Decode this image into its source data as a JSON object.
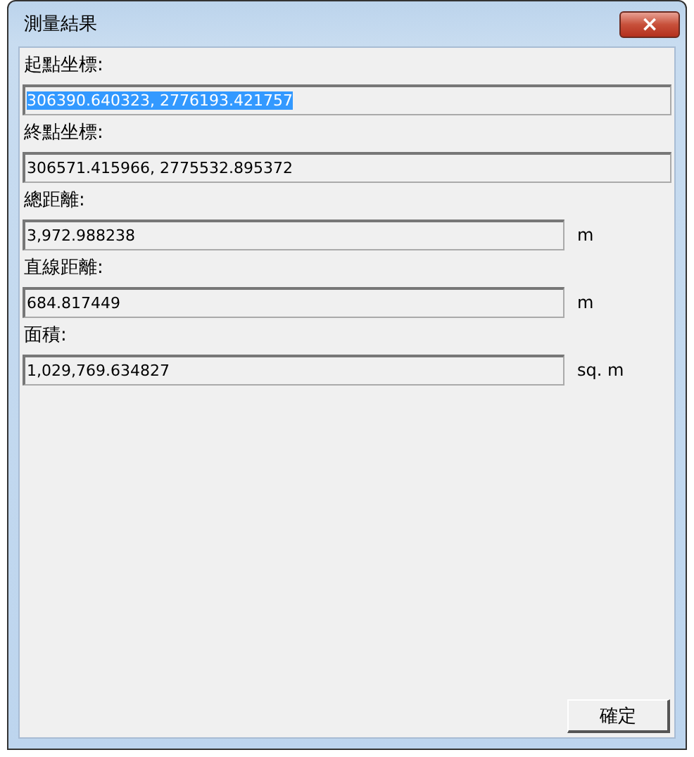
{
  "window": {
    "title": "測量結果",
    "close": "×"
  },
  "fields": [
    {
      "label": "起點坐標:",
      "value": "306390.640323, 2776193.421757",
      "selected": true
    },
    {
      "label": "終點坐標:",
      "value": "306571.415966, 2775532.895372",
      "selected": false
    },
    {
      "label": "總距離:",
      "value": "3,972.988238",
      "unit": "m",
      "selected": false
    },
    {
      "label": "直線距離:",
      "value": "684.817449",
      "unit": "m",
      "selected": false
    },
    {
      "label": "面積:",
      "value": "1,029,769.634827",
      "unit": "sq. m",
      "selected": false
    }
  ],
  "buttons": [
    "確定"
  ]
}
